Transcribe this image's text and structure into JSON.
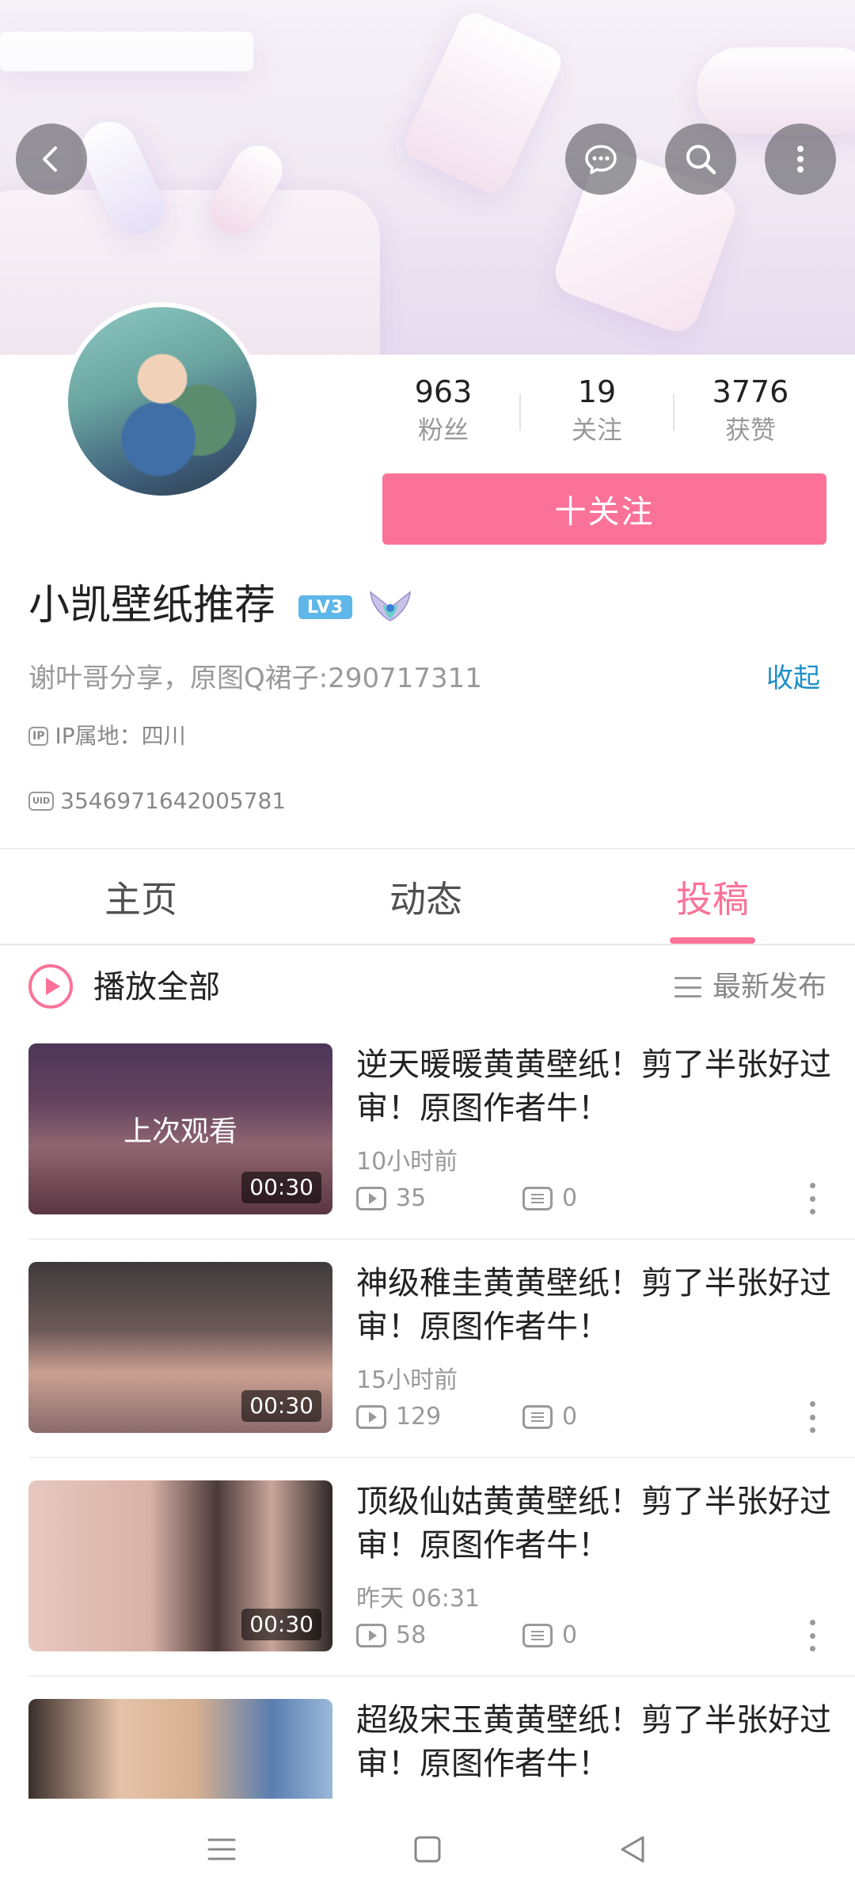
{
  "profile": {
    "name": "小凯壁纸推荐",
    "level": "LV3",
    "bio": "谢叶哥分享，原图Q裙子:290717311",
    "collapse_label": "收起",
    "ip_tag": "IP",
    "ip_location": "IP属地：四川",
    "uid_tag": "UID",
    "uid": "3546971642005781",
    "follow_label": "十关注"
  },
  "stats": [
    {
      "value": "963",
      "label": "粉丝"
    },
    {
      "value": "19",
      "label": "关注"
    },
    {
      "value": "3776",
      "label": "获赞"
    }
  ],
  "tabs": [
    {
      "label": "主页",
      "active": false
    },
    {
      "label": "动态",
      "active": false
    },
    {
      "label": "投稿",
      "active": true
    }
  ],
  "list_header": {
    "play_all_label": "播放全部",
    "sort_label": "最新发布"
  },
  "videos": [
    {
      "title": "逆天暖暖黄黄壁纸！剪了半张好过审！原图作者牛！",
      "time": "10小时前",
      "views": "35",
      "comments": "0",
      "duration": "00:30",
      "overlay": "上次观看"
    },
    {
      "title": "神级稚圭黄黄壁纸！剪了半张好过审！原图作者牛！",
      "time": "15小时前",
      "views": "129",
      "comments": "0",
      "duration": "00:30"
    },
    {
      "title": "顶级仙姑黄黄壁纸！剪了半张好过审！原图作者牛！",
      "time": "昨天 06:31",
      "views": "58",
      "comments": "0",
      "duration": "00:30"
    },
    {
      "title": "超级宋玉黄黄壁纸！剪了半张好过审！原图作者牛！",
      "time": "",
      "views": "",
      "comments": "",
      "duration": ""
    }
  ],
  "colors": {
    "accent": "#fb7299",
    "link": "#1b8fc7",
    "level_badge": "#5fb6e8"
  }
}
